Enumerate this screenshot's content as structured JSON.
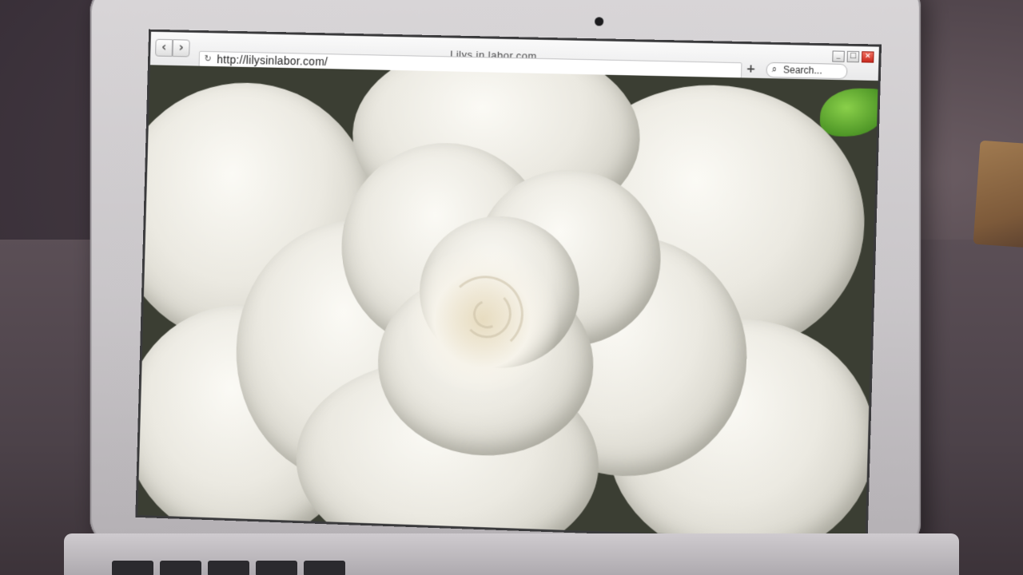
{
  "browser": {
    "url": "http://lilysinlabor.com/",
    "page_title": "Lilys in labor.com",
    "search_placeholder": "Search...",
    "new_tab_label": "+",
    "nav": {
      "back_icon": "chevron-left-icon",
      "forward_icon": "chevron-right-icon"
    },
    "window_controls": {
      "minimize_label": "_",
      "maximize_label": "□",
      "close_label": "×",
      "close_color": "#d93a2b"
    }
  },
  "page_content": {
    "image_subject": "white gardenia flower close-up"
  }
}
